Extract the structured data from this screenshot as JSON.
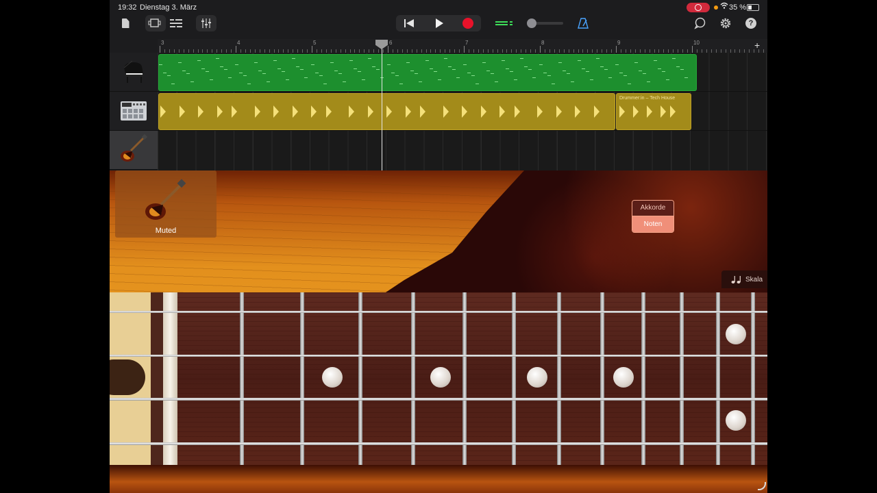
{
  "status": {
    "time": "19:32",
    "date": "Dienstag 3. März",
    "battery": "35 %",
    "battery_level": 0.35
  },
  "toolbar": {
    "icons": [
      "document-icon",
      "view-toggle-icon",
      "tracks-view-icon",
      "mixer-icon",
      "rewind-icon",
      "play-icon",
      "record-icon",
      "lcd-icon",
      "volume-slider",
      "metronome-icon",
      "loop-browser-icon",
      "settings-icon",
      "help-icon"
    ],
    "help_label": "?",
    "volume_level": 0.1
  },
  "ruler": {
    "bars": [
      "3",
      "4",
      "5",
      "6",
      "7",
      "8",
      "9",
      "10"
    ],
    "add_label": "+"
  },
  "tracks": [
    {
      "name": "piano",
      "icon": "grand-piano-icon"
    },
    {
      "name": "drummer",
      "icon": "drum-machine-icon"
    },
    {
      "name": "bass",
      "icon": "bass-guitar-icon",
      "selected": true
    }
  ],
  "regions": [
    {
      "track": "piano",
      "color": "#1d8f2e"
    },
    {
      "track": "drummer",
      "color": "#a38b1a"
    },
    {
      "track": "drummer",
      "color": "#a38b1a",
      "label": "Drummer:in – Tech House"
    }
  ],
  "instrument": {
    "muted_label": "Muted",
    "mode_options": [
      "Akkorde",
      "Noten"
    ],
    "mode_selected": "Noten",
    "scale_label": "Skala",
    "scale_icon": "music-notes-icon"
  },
  "colors": {
    "record": "#e8122a",
    "accent_green": "#1d8f2e",
    "accent_gold": "#a38b1a",
    "mode_selected": "#f08f79"
  }
}
